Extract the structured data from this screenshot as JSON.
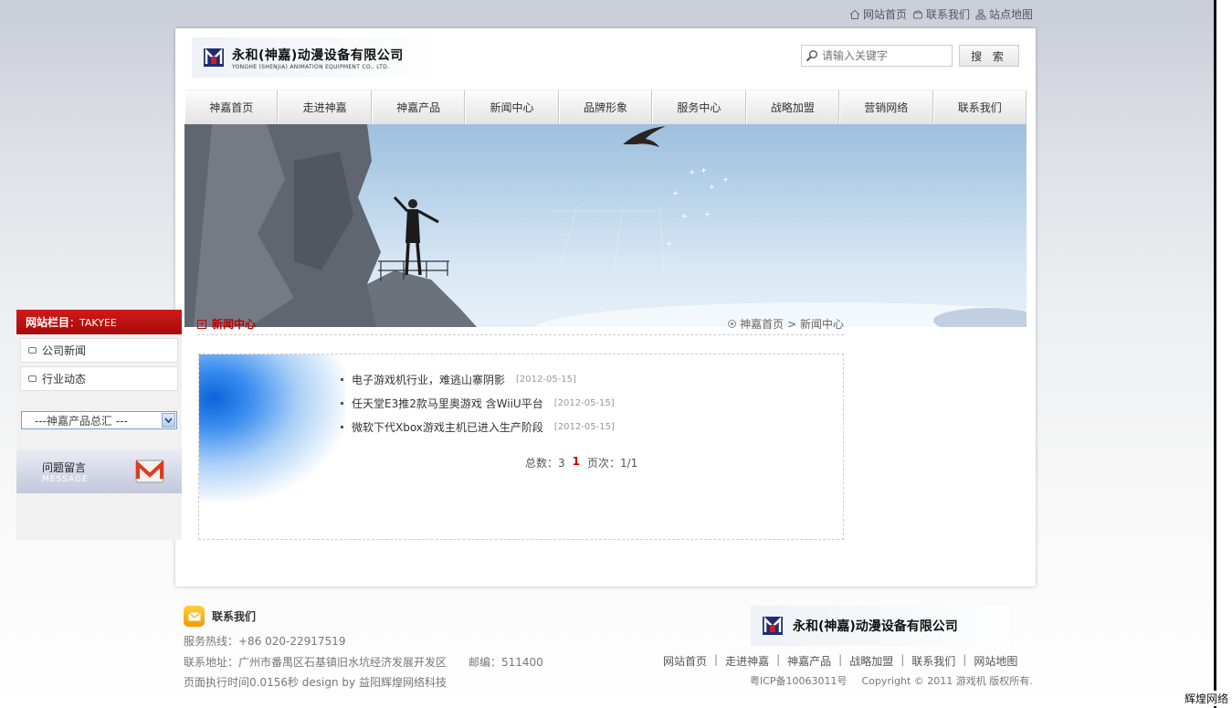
{
  "top_links": [
    {
      "label": "网站首页",
      "icon": "home-icon"
    },
    {
      "label": "联系我们",
      "icon": "phone-icon"
    },
    {
      "label": "站点地图",
      "icon": "sitemap-icon"
    }
  ],
  "brand": {
    "name_cn": "永和(神嘉)动漫设备有限公司",
    "name_en": "YONGHE (SHENJIA) ANIMATION EQUIPMENT CO., LTD."
  },
  "search": {
    "placeholder": "请输入关键字",
    "button": "搜 索"
  },
  "nav": [
    "神嘉首页",
    "走进神嘉",
    "神嘉产品",
    "新闻中心",
    "品牌形象",
    "服务中心",
    "战略加盟",
    "营销网络",
    "联系我们"
  ],
  "sidebar": {
    "title": "网站栏目",
    "title_en": "：TAKYEE",
    "items": [
      "公司新闻",
      "行业动态"
    ],
    "select_value": "---神嘉产品总汇 ---",
    "message_cn": "问题留言",
    "message_en": "MESSAGE"
  },
  "content": {
    "title": "新闻中心",
    "breadcrumb_home": "神嘉首页",
    "breadcrumb_current": "> 新闻中心",
    "news": [
      {
        "title": "电子游戏机行业，难逃山寨阴影",
        "date": "[2012-05-15]"
      },
      {
        "title": "任天堂E3推2款马里奥游戏 含WiiU平台",
        "date": "[2012-05-15]"
      },
      {
        "title": "微软下代Xbox游戏主机已进入生产阶段",
        "date": "[2012-05-15]"
      }
    ],
    "pager": {
      "total": "总数：3",
      "page": "1",
      "pages": "页次：1/1"
    }
  },
  "footer": {
    "contact_title": "联系我们",
    "hotline": "服务热线：+86 020-22917519",
    "address": "联系地址：广州市番禺区石基镇旧水坑经济发展开发区　　邮编：511400",
    "exec": "页面执行时间0.0156秒  design by 益阳辉煌网络科技",
    "links": [
      "网站首页",
      "走进神嘉",
      "神嘉产品",
      "战略加盟",
      "联系我们",
      "网站地图"
    ],
    "separator": "|",
    "icp": "粤ICP备10063011号",
    "copyright": "Copyright © 2011 游戏机 版权所有."
  },
  "corner_label": "辉煌网络",
  "colors": {
    "accent_red": "#b00000",
    "nav_bg": "#e8e8e8",
    "page_bg": "#dde0e6"
  }
}
